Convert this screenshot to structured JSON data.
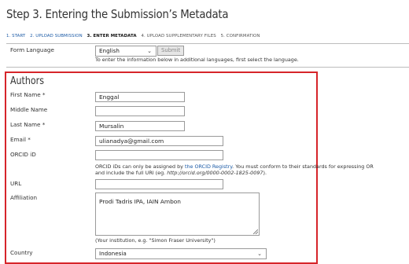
{
  "page": {
    "title": "Step 3. Entering the Submission’s Metadata",
    "steps": [
      {
        "label": "1. START",
        "state": "link"
      },
      {
        "label": "2. UPLOAD SUBMISSION",
        "state": "link"
      },
      {
        "label": "3. ENTER METADATA",
        "state": "current"
      },
      {
        "label": "4. UPLOAD SUPPLEMENTARY FILES",
        "state": "plain"
      },
      {
        "label": "5. CONFIRMATION",
        "state": "plain"
      }
    ]
  },
  "form_language": {
    "label": "Form Language",
    "value": "English",
    "submit_label": "Submit",
    "help": "To enter the information below in additional languages, first select the language."
  },
  "authors": {
    "heading": "Authors",
    "first_name_label": "First Name *",
    "first_name_value": "Enggal",
    "middle_name_label": "Middle Name",
    "middle_name_value": "",
    "last_name_label": "Last Name *",
    "last_name_value": "Mursalin",
    "email_label": "Email *",
    "email_value": "ulianadya@gmail.com",
    "orcid_label": "ORCID iD",
    "orcid_value": "",
    "orcid_help_1_pre": "ORCID iDs can only be assigned by ",
    "orcid_help_1_link": "the ORCID Registry",
    "orcid_help_1_post": ". You must conform to their standards for expressing OR",
    "orcid_help_2_pre": "and include the full URI (eg. ",
    "orcid_help_2_example": "http://orcid.org/0000-0002-1825-0097",
    "orcid_help_2_post": ").",
    "url_label": "URL",
    "url_value": "",
    "affiliation_label": "Affiliation",
    "affiliation_value": "Prodi Tadris IPA, IAIN Ambon",
    "affiliation_help": "(Your institution, e.g. \"Simon Fraser University\")",
    "country_label": "Country",
    "country_value": "Indonesia"
  },
  "colors": {
    "highlight_border": "#d6252a",
    "link": "#1b5aa6"
  }
}
